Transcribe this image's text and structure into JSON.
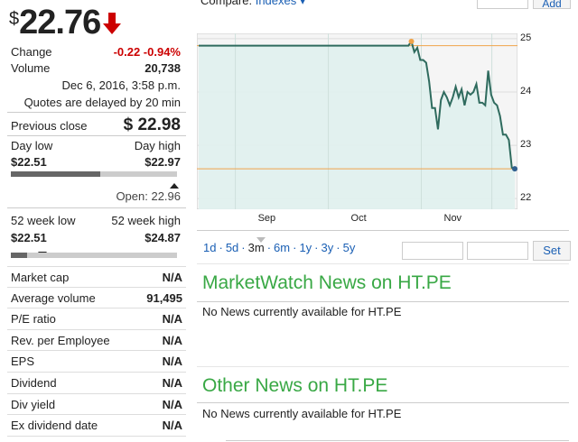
{
  "quote": {
    "currency": "$",
    "price": "22.76",
    "change_label": "Change",
    "change_value": "-0.22 -0.94%",
    "volume_label": "Volume",
    "volume_value": "20,738",
    "datetime": "Dec 6, 2016, 3:58 p.m.",
    "delay_note": "Quotes are delayed by 20 min",
    "prev_close_label": "Previous close",
    "prev_close_value": "$ 22.98",
    "day_low_label": "Day low",
    "day_high_label": "Day high",
    "day_low": "$22.51",
    "day_high": "$22.97",
    "day_range_fraction": 0.54,
    "open_text": "Open: 22.96",
    "wk_low_label": "52 week low",
    "wk_high_label": "52 week high",
    "wk_low": "$22.51",
    "wk_high": "$24.87",
    "wk_range_fraction": 0.1
  },
  "stats": [
    {
      "label": "Market cap",
      "value": "N/A"
    },
    {
      "label": "Average volume",
      "value": "91,495"
    },
    {
      "label": "P/E ratio",
      "value": "N/A"
    },
    {
      "label": "Rev. per Employee",
      "value": "N/A"
    },
    {
      "label": "EPS",
      "value": "N/A"
    },
    {
      "label": "Dividend",
      "value": "N/A"
    },
    {
      "label": "Div yield",
      "value": "N/A"
    },
    {
      "label": "Ex dividend date",
      "value": "N/A"
    }
  ],
  "compare": {
    "label": "Compare:",
    "select": "Indexes",
    "add": "Add"
  },
  "chart_data": {
    "type": "line",
    "x_ticks": [
      "Sep",
      "Oct",
      "Nov"
    ],
    "y_ticks": [
      "25",
      "24",
      "23",
      "22"
    ],
    "ylim": [
      21.8,
      25.1
    ],
    "values": [
      24.87,
      24.87,
      24.87,
      24.87,
      24.87,
      24.87,
      24.87,
      24.87,
      24.87,
      24.87,
      24.87,
      24.87,
      24.87,
      24.87,
      24.87,
      24.87,
      24.87,
      24.87,
      24.87,
      24.87,
      24.87,
      24.87,
      24.87,
      24.87,
      24.87,
      24.87,
      24.87,
      24.87,
      24.87,
      24.87,
      24.87,
      24.87,
      24.87,
      24.87,
      24.87,
      24.87,
      24.87,
      24.87,
      24.87,
      24.87,
      24.87,
      24.87,
      24.87,
      24.87,
      24.87,
      24.87,
      24.87,
      24.87,
      24.87,
      24.87,
      24.87,
      24.87,
      24.87,
      24.87,
      24.87,
      24.87,
      24.87,
      24.87,
      24.87,
      24.87,
      24.87,
      24.87,
      24.87,
      24.87,
      24.87,
      24.87,
      24.87,
      24.87,
      24.87,
      24.87,
      24.87,
      24.87,
      24.95,
      24.75,
      24.83,
      24.6,
      24.6,
      24.55,
      24.2,
      23.7,
      23.7,
      23.3,
      23.85,
      24.0,
      23.9,
      23.75,
      23.9,
      24.1,
      23.9,
      24.05,
      23.75,
      24.0,
      23.95,
      24.0,
      24.15,
      23.8,
      23.8,
      23.75,
      24.4,
      23.95,
      23.8,
      23.75,
      23.55,
      23.2,
      23.2,
      23.1,
      22.58,
      22.56
    ],
    "grid": true,
    "reference_lines": [
      24.87,
      22.56
    ]
  },
  "ranges": [
    "1d",
    "5d",
    "3m",
    "6m",
    "1y",
    "3y",
    "5y"
  ],
  "selected_range": "3m",
  "set_label": "Set",
  "news": [
    {
      "title": "MarketWatch News on HT.PE",
      "text": "No News currently available for HT.PE"
    },
    {
      "title": "Other News on HT.PE",
      "text": "No News currently available for HT.PE"
    }
  ],
  "colors": {
    "accent": "#39a845",
    "negative": "#cc0000",
    "link": "#1a5fb4",
    "chart_fill": "#e0f1ee",
    "chart_line": "#2f6b5e",
    "ref_line": "#f0a44b"
  }
}
